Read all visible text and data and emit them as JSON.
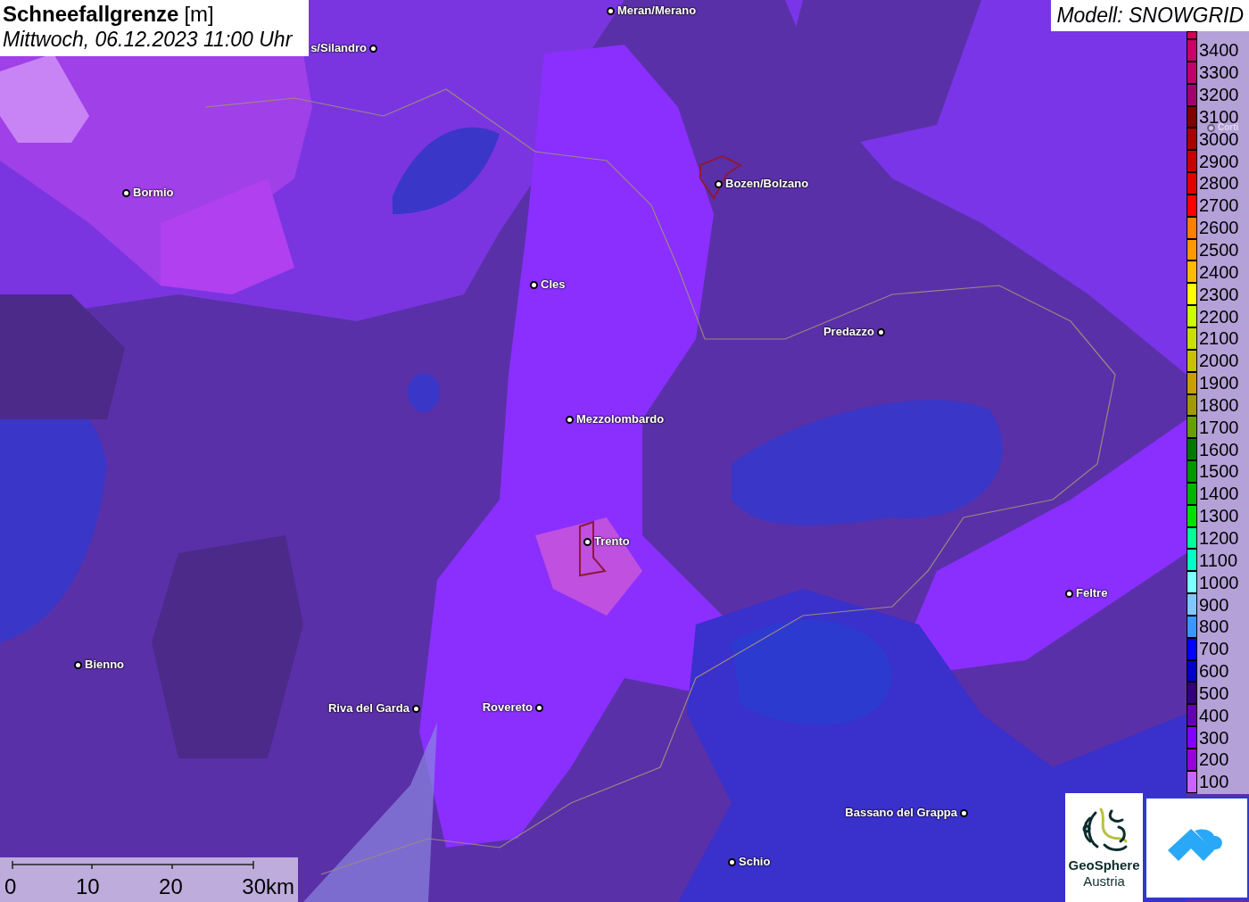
{
  "title": {
    "name": "Schneefallgrenze",
    "unit": "[m]",
    "time": "Mittwoch, 06.12.2023 11:00 Uhr"
  },
  "model": "Modell: SNOWGRID",
  "cities": [
    {
      "name": "Meran/Merano"
    },
    {
      "name": "s/Silandro"
    },
    {
      "name": "Bormio"
    },
    {
      "name": "Bozen/Bolzano"
    },
    {
      "name": "Cles"
    },
    {
      "name": "Predazzo"
    },
    {
      "name": "Mezzolombardo"
    },
    {
      "name": "Trento"
    },
    {
      "name": "Feltre"
    },
    {
      "name": "Bienno"
    },
    {
      "name": "Riva del Garda"
    },
    {
      "name": "Rovereto"
    },
    {
      "name": "Bassano del Grappa"
    },
    {
      "name": "Schio"
    },
    {
      "name": "Corti"
    }
  ],
  "legend": [
    {
      "label": "3400",
      "color": "#cc0066"
    },
    {
      "label": "3300",
      "color": "#c0006e"
    },
    {
      "label": "3200",
      "color": "#a00070"
    },
    {
      "label": "3100",
      "color": "#800000"
    },
    {
      "label": "3000",
      "color": "#a80000"
    },
    {
      "label": "2900",
      "color": "#c80000"
    },
    {
      "label": "2800",
      "color": "#e00000"
    },
    {
      "label": "2700",
      "color": "#ff0000"
    },
    {
      "label": "2600",
      "color": "#ff8000"
    },
    {
      "label": "2500",
      "color": "#ff9900"
    },
    {
      "label": "2400",
      "color": "#ffbb00"
    },
    {
      "label": "2300",
      "color": "#ffff00"
    },
    {
      "label": "2200",
      "color": "#ccff00"
    },
    {
      "label": "2100",
      "color": "#c8e000"
    },
    {
      "label": "2000",
      "color": "#c8c000"
    },
    {
      "label": "1900",
      "color": "#c8a000"
    },
    {
      "label": "1800",
      "color": "#a09a00"
    },
    {
      "label": "1700",
      "color": "#66a000"
    },
    {
      "label": "1600",
      "color": "#007800"
    },
    {
      "label": "1500",
      "color": "#009600"
    },
    {
      "label": "1400",
      "color": "#00b400"
    },
    {
      "label": "1300",
      "color": "#00e000"
    },
    {
      "label": "1200",
      "color": "#00ff96"
    },
    {
      "label": "1100",
      "color": "#00ffc8"
    },
    {
      "label": "1000",
      "color": "#80ffff"
    },
    {
      "label": "900",
      "color": "#80c8ff"
    },
    {
      "label": "800",
      "color": "#3c96ff"
    },
    {
      "label": "700",
      "color": "#0000ff"
    },
    {
      "label": "600",
      "color": "#0000c8"
    },
    {
      "label": "500",
      "color": "#320078"
    },
    {
      "label": "400",
      "color": "#6400b4"
    },
    {
      "label": "300",
      "color": "#8200ff"
    },
    {
      "label": "200",
      "color": "#9600dc"
    },
    {
      "label": "100",
      "color": "#c864ff"
    }
  ],
  "scale": [
    "0",
    "10",
    "20",
    "30km"
  ],
  "logo": {
    "line1": "GeoSphere",
    "line2": "Austria"
  }
}
